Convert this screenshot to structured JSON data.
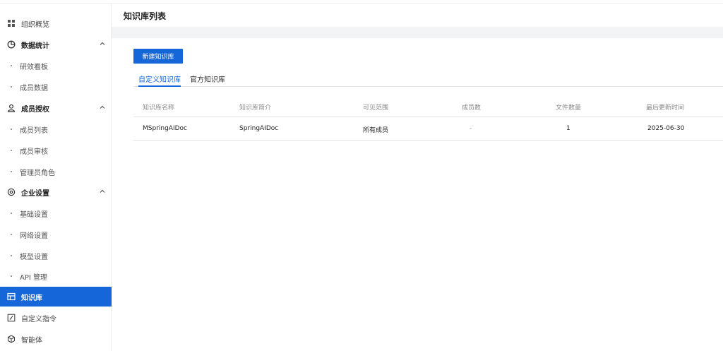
{
  "sidebar": {
    "items": [
      {
        "label": "组织概览",
        "icon": "grid-icon"
      },
      {
        "label": "数据统计",
        "icon": "pie-chart-icon"
      },
      {
        "label": "研效看板"
      },
      {
        "label": "成员数据"
      },
      {
        "label": "成员授权",
        "icon": "user-icon"
      },
      {
        "label": "成员列表"
      },
      {
        "label": "成员审核"
      },
      {
        "label": "管理员角色"
      },
      {
        "label": "企业设置",
        "icon": "gear-icon"
      },
      {
        "label": "基础设置"
      },
      {
        "label": "网络设置"
      },
      {
        "label": "模型设置"
      },
      {
        "label": "API 管理"
      },
      {
        "label": "知识库",
        "icon": "table-icon"
      },
      {
        "label": "自定义指令",
        "icon": "edit-box-icon"
      },
      {
        "label": "智能体",
        "icon": "cube-icon"
      }
    ]
  },
  "main": {
    "title": "知识库列表",
    "new_button": "新建知识库",
    "tabs": [
      "自定义知识库",
      "官方知识库"
    ],
    "table": {
      "headers": [
        "知识库名称",
        "知识库简介",
        "可见范围",
        "成员数",
        "文件数量",
        "最后更新时间"
      ],
      "rows": [
        [
          "MSpringAIDoc",
          "SpringAIDoc",
          "所有成员",
          "-",
          "1",
          "2025-06-30"
        ]
      ]
    }
  },
  "colors": {
    "accent": "#1566d8"
  }
}
